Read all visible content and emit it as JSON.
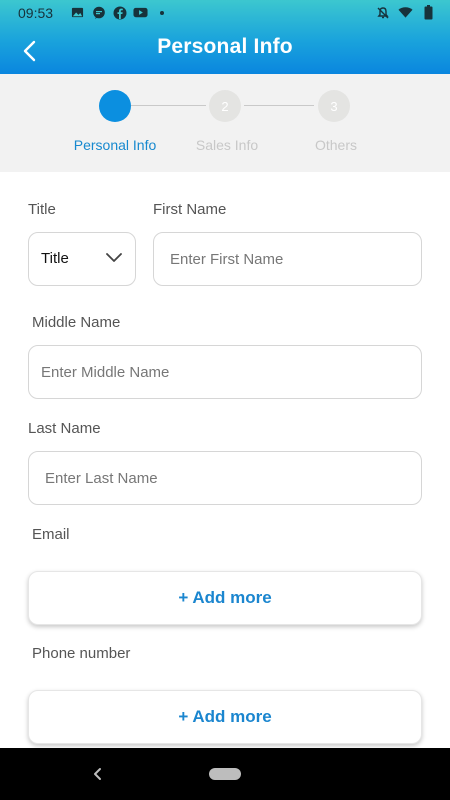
{
  "status_bar": {
    "time": "09:53",
    "left_icons": [
      "image-icon",
      "chat-icon",
      "facebook-icon",
      "youtube-icon",
      "dot-icon"
    ],
    "right_icons": [
      "mute-icon",
      "wifi-icon",
      "battery-icon"
    ]
  },
  "app_bar": {
    "title": "Personal Info",
    "back_icon": "chevron-left-icon"
  },
  "stepper": {
    "steps": [
      {
        "number": "1",
        "label": "Personal Info",
        "active": true
      },
      {
        "number": "2",
        "label": "Sales Info",
        "active": false
      },
      {
        "number": "3",
        "label": "Others",
        "active": false
      }
    ],
    "active_color": "#0b8fe0",
    "inactive_color": "#e4e4e2"
  },
  "form": {
    "title_label": "Title",
    "title_value": "Title",
    "first_name_label": "First Name",
    "first_name_placeholder": "Enter First Name",
    "middle_name_label": "Middle Name",
    "middle_name_placeholder": "Enter Middle Name",
    "last_name_label": "Last Name",
    "last_name_placeholder": "Enter Last Name",
    "email_label": "Email",
    "email_add_label": "+ Add more",
    "phone_label": "Phone number",
    "phone_add_label": "+ Add more"
  },
  "colors": {
    "header_gradient_top": "#3cc7cf",
    "header_gradient_bottom": "#0a86df",
    "accent": "#1b86cf"
  }
}
